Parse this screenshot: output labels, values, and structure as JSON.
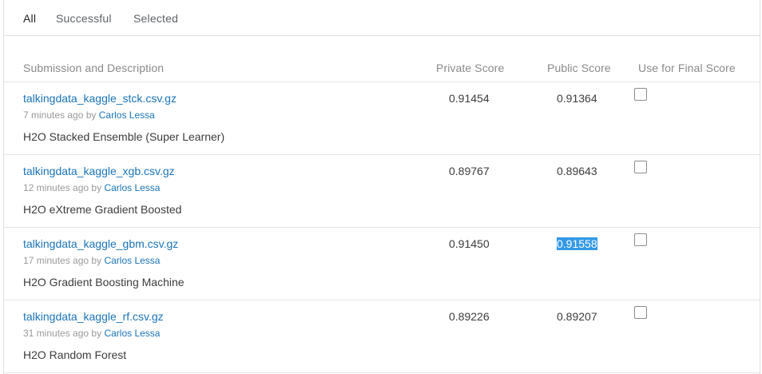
{
  "tabs": {
    "all": "All",
    "successful": "Successful",
    "selected": "Selected"
  },
  "header": {
    "submission": "Submission and Description",
    "private_score": "Private Score",
    "public_score": "Public Score",
    "final_score": "Use for Final Score"
  },
  "rows": [
    {
      "file": "talkingdata_kaggle_stck.csv.gz",
      "time": "7 minutes ago",
      "by": "by",
      "author": "Carlos Lessa",
      "description": "H2O Stacked Ensemble (Super Learner)",
      "private_score": "0.91454",
      "public_score": "0.91364",
      "use_for_final": false
    },
    {
      "file": "talkingdata_kaggle_xgb.csv.gz",
      "time": "12 minutes ago",
      "by": "by",
      "author": "Carlos Lessa",
      "description": "H2O eXtreme Gradient Boosted",
      "private_score": "0.89767",
      "public_score": "0.89643",
      "use_for_final": false
    },
    {
      "file": "talkingdata_kaggle_gbm.csv.gz",
      "time": "17 minutes ago",
      "by": "by",
      "author": "Carlos Lessa",
      "description": "H2O Gradient Boosting Machine",
      "private_score": "0.91450",
      "public_score": "0.91558",
      "public_score_selected": true,
      "use_for_final": false
    },
    {
      "file": "talkingdata_kaggle_rf.csv.gz",
      "time": "31 minutes ago",
      "by": "by",
      "author": "Carlos Lessa",
      "description": "H2O Random Forest",
      "private_score": "0.89226",
      "public_score": "0.89207",
      "use_for_final": false
    }
  ],
  "colors": {
    "link": "#1a73b8",
    "selection": "#3399e6"
  }
}
